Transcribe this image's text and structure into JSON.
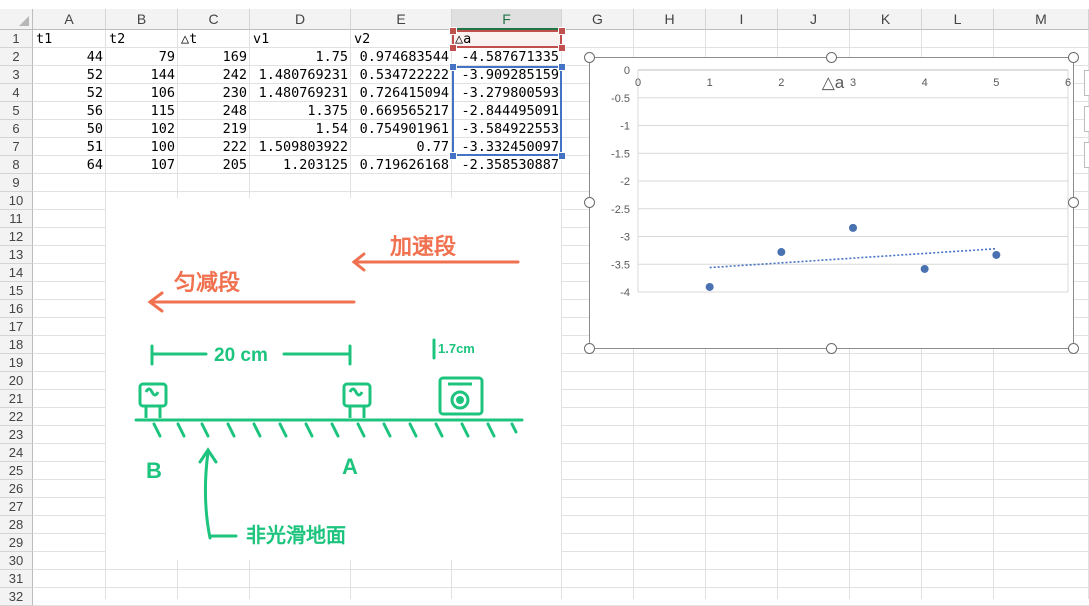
{
  "columns": [
    "A",
    "B",
    "C",
    "D",
    "E",
    "F",
    "G",
    "H",
    "I",
    "J",
    "K",
    "L",
    "M"
  ],
  "rows": [
    "1",
    "2",
    "3",
    "4",
    "5",
    "6",
    "7",
    "8",
    "9",
    "10",
    "11",
    "12",
    "13",
    "14",
    "15",
    "16",
    "17",
    "18",
    "19",
    "20",
    "21",
    "22",
    "23",
    "24",
    "25",
    "26",
    "27",
    "28",
    "29",
    "30",
    "31",
    "32"
  ],
  "headers": [
    "t1",
    "t2",
    "△t",
    "v1",
    "v2",
    "△a"
  ],
  "table": [
    [
      "44",
      "79",
      "169",
      "1.75",
      "0.974683544",
      "-4.587671335"
    ],
    [
      "52",
      "144",
      "242",
      "1.480769231",
      "0.534722222",
      "-3.909285159"
    ],
    [
      "52",
      "106",
      "230",
      "1.480769231",
      "0.726415094",
      "-3.279800593"
    ],
    [
      "56",
      "115",
      "248",
      "1.375",
      "0.669565217",
      "-2.844495091"
    ],
    [
      "50",
      "102",
      "219",
      "1.54",
      "0.754901961",
      "-3.584922553"
    ],
    [
      "51",
      "100",
      "222",
      "1.509803922",
      "0.77",
      "-3.332450097"
    ],
    [
      "64",
      "107",
      "205",
      "1.203125",
      "0.719626168",
      "-2.358530887"
    ]
  ],
  "drawing": {
    "top_right_label": "加速段",
    "top_left_label": "匀减段",
    "distance_label": "20 cm",
    "small_label": "1.7cm",
    "point_b": "B",
    "point_a": "A",
    "surface_label": "非光滑地面",
    "ink_orange": "#f0714f",
    "ink_green": "#1dc47e"
  },
  "chart_data": {
    "type": "scatter",
    "title": "△a",
    "x": [
      1,
      2,
      3,
      4,
      5
    ],
    "y": [
      -3.909285159,
      -3.279800593,
      -2.844495091,
      -3.584922553,
      -3.332450097
    ],
    "xlim": [
      0,
      6
    ],
    "ylim": [
      -4,
      0
    ],
    "x_ticks": [
      "0",
      "1",
      "2",
      "3",
      "4",
      "5",
      "6"
    ],
    "y_ticks": [
      "0",
      "-0.5",
      "-1",
      "-1.5",
      "-2",
      "-2.5",
      "-3",
      "-3.5",
      "-4"
    ],
    "trendline": {
      "type": "linear",
      "style": "dotted"
    },
    "grid": "horizontal",
    "marker_color": "#4a72b0",
    "trend_color": "#4472c4"
  }
}
